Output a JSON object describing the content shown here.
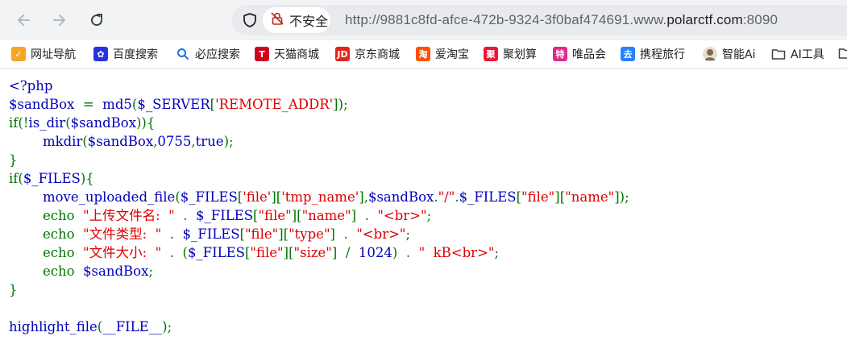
{
  "browser": {
    "security_label": "不安全",
    "url_prefix": "http://9881c8fd-afce-472b-9324-3f0baf474691.www.",
    "url_host": "polarctf.com",
    "url_suffix": ":8090"
  },
  "bookmarks": [
    {
      "label": "网址导航",
      "icon": "hao123-icon",
      "color": "#f5a623",
      "glyph": "✓"
    },
    {
      "label": "百度搜索",
      "icon": "baidu-paw-icon",
      "color": "#2932e1",
      "glyph": "✿"
    },
    {
      "label": "必应搜索",
      "icon": "search-icon",
      "color": "#1a73e8",
      "glyph": "Q"
    },
    {
      "label": "天猫商城",
      "icon": "tmall-icon",
      "color": "#d0021b",
      "glyph": "T"
    },
    {
      "label": "京东商城",
      "icon": "jd-icon",
      "color": "#e1251b",
      "glyph": "JD"
    },
    {
      "label": "爱淘宝",
      "icon": "taobao-icon",
      "color": "#ff5000",
      "glyph": "淘"
    },
    {
      "label": "聚划算",
      "icon": "juhuasuan-icon",
      "color": "#e8173a",
      "glyph": "聚"
    },
    {
      "label": "唯品会",
      "icon": "vip-icon",
      "color": "#e0288f",
      "glyph": "特"
    },
    {
      "label": "携程旅行",
      "icon": "ctrip-icon",
      "color": "#2681ff",
      "glyph": "去"
    },
    {
      "label": "智能Ai",
      "icon": "avatar-icon",
      "color": "#7a6a5a",
      "glyph": "●"
    },
    {
      "label": "AI工具",
      "icon": "folder-icon",
      "color": "#ffffff",
      "glyph": ""
    }
  ],
  "code": {
    "lines": [
      [
        "<?php"
      ],
      [
        "$sandBox  =  md5($_SERVER[",
        "'REMOTE_ADDR'",
        "]);"
      ],
      [
        "if(!is_dir($sandBox)){"
      ],
      [
        "        ",
        "mkdir($sandBox,0755,true);"
      ],
      [
        "}"
      ],
      [
        "if($_FILES){"
      ],
      [
        "        ",
        "move_uploaded_file($_FILES[",
        "'file'",
        "][",
        "'tmp_name'",
        "],$sandBox.",
        "\"/\"",
        ".$_FILES[",
        "\"file\"",
        "][",
        "\"name\"",
        "]);"
      ],
      [
        "        ",
        "echo  ",
        "\"上传文件名:  \"",
        "  .  $_FILES[",
        "\"file\"",
        "][",
        "\"name\"",
        "]  .  ",
        "\"<br>\"",
        ";"
      ],
      [
        "        ",
        "echo  ",
        "\"文件类型:  \"",
        "  .  $_FILES[",
        "\"file\"",
        "][",
        "\"type\"",
        "]  .  ",
        "\"<br>\"",
        ";"
      ],
      [
        "        ",
        "echo  ",
        "\"文件大小:  \"",
        "  .  ($_FILES[",
        "\"file\"",
        "][",
        "\"size\"",
        "]  /  1024)  .  ",
        "\"  kB<br>\"",
        ";"
      ],
      [
        "        ",
        "echo  ",
        "$sandBox;"
      ],
      [
        "}"
      ],
      [
        ""
      ],
      [
        "highlight_file(__FILE__);"
      ]
    ]
  },
  "colors": {
    "default": "#0000bb",
    "keyword": "#007700",
    "string": "#dd0000"
  }
}
